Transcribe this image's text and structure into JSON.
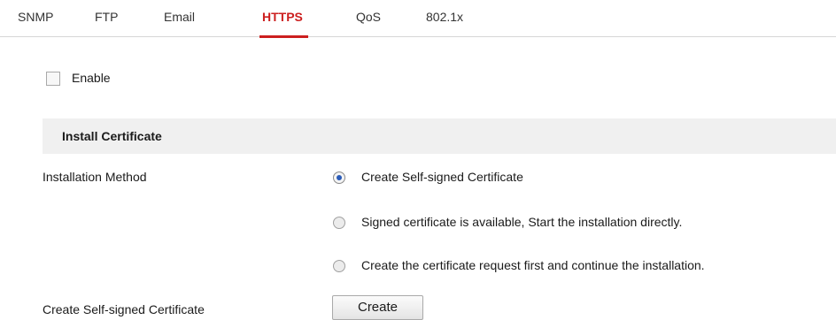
{
  "tabs": [
    {
      "label": "SNMP",
      "active": false
    },
    {
      "label": "FTP",
      "active": false
    },
    {
      "label": "Email",
      "active": false
    },
    {
      "label": "HTTPS",
      "active": true
    },
    {
      "label": "QoS",
      "active": false
    },
    {
      "label": "802.1x",
      "active": false
    }
  ],
  "enable": {
    "label": "Enable",
    "checked": false
  },
  "section": {
    "title": "Install Certificate"
  },
  "installation_method": {
    "label": "Installation Method",
    "options": [
      {
        "label": "Create Self-signed Certificate",
        "selected": true
      },
      {
        "label": "Signed certificate is available, Start the installation directly.",
        "selected": false
      },
      {
        "label": "Create the certificate request first and continue the installation.",
        "selected": false
      }
    ]
  },
  "create_self_signed": {
    "label": "Create Self-signed Certificate",
    "button_label": "Create"
  },
  "colors": {
    "accent": "#cc1f1f",
    "section_bg": "#f0f0f0",
    "radio_dot": "#2b5cb8"
  }
}
